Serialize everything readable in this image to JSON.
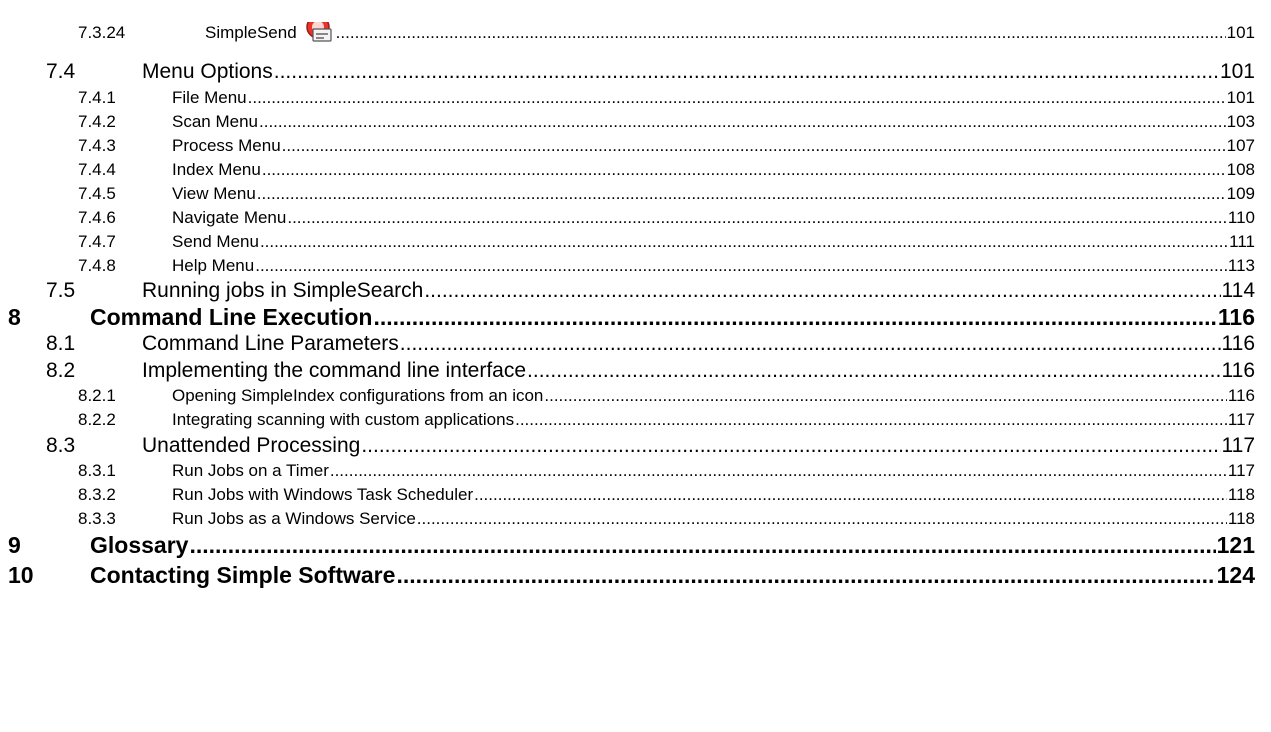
{
  "toc": [
    {
      "num": "7.3.24",
      "title": "SimpleSend",
      "page": "101",
      "level": 3,
      "icon": "simplesend-icon"
    },
    {
      "num": "7.4",
      "title": "Menu Options",
      "page": "101",
      "level": 2
    },
    {
      "num": "7.4.1",
      "title": "File Menu",
      "page": "101",
      "level": 3
    },
    {
      "num": "7.4.2",
      "title": "Scan Menu",
      "page": "103",
      "level": 3
    },
    {
      "num": "7.4.3",
      "title": "Process Menu",
      "page": "107",
      "level": 3
    },
    {
      "num": "7.4.4",
      "title": "Index Menu",
      "page": "108",
      "level": 3
    },
    {
      "num": "7.4.5",
      "title": "View Menu",
      "page": "109",
      "level": 3
    },
    {
      "num": "7.4.6",
      "title": "Navigate Menu",
      "page": "110",
      "level": 3
    },
    {
      "num": "7.4.7",
      "title": "Send Menu",
      "page": "111",
      "level": 3
    },
    {
      "num": "7.4.8",
      "title": "Help Menu",
      "page": "113",
      "level": 3
    },
    {
      "num": "7.5",
      "title": "Running jobs in SimpleSearch",
      "page": "114",
      "level": 2
    },
    {
      "num": "8",
      "title": "Command Line Execution",
      "page": "116",
      "level": 1
    },
    {
      "num": "8.1",
      "title": "Command Line Parameters",
      "page": "116",
      "level": 2
    },
    {
      "num": "8.2",
      "title": "Implementing the command line interface",
      "page": "116",
      "level": 2
    },
    {
      "num": "8.2.1",
      "title": "Opening SimpleIndex configurations from an icon",
      "page": "116",
      "level": 3
    },
    {
      "num": "8.2.2",
      "title": "Integrating scanning with custom applications",
      "page": "117",
      "level": 3
    },
    {
      "num": "8.3",
      "title": "Unattended Processing",
      "page": "117",
      "level": 2
    },
    {
      "num": "8.3.1",
      "title": "Run Jobs on a Timer",
      "page": "117",
      "level": 3
    },
    {
      "num": "8.3.2",
      "title": "Run Jobs with Windows Task Scheduler",
      "page": "118",
      "level": 3
    },
    {
      "num": "8.3.3",
      "title": "Run Jobs as a Windows Service",
      "page": "118",
      "level": 3
    },
    {
      "num": "9",
      "title": "Glossary",
      "page": "121",
      "level": 1
    },
    {
      "num": "10",
      "title": "Contacting Simple Software",
      "page": "124",
      "level": 1
    }
  ]
}
